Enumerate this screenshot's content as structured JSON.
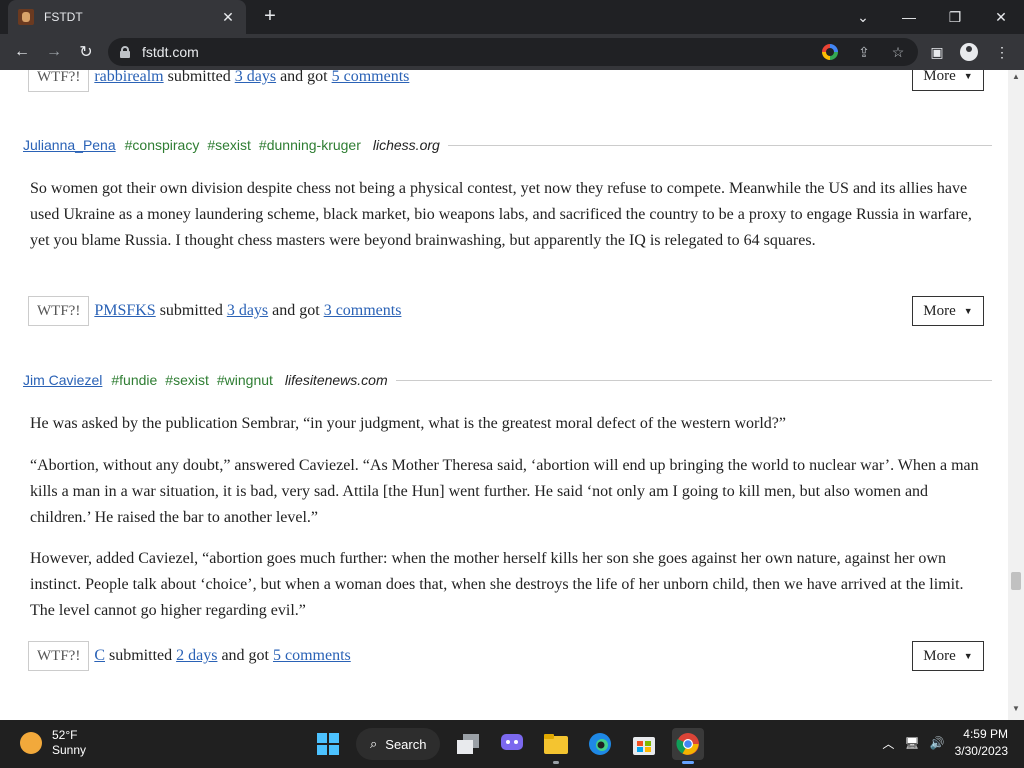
{
  "browser": {
    "tab_title": "FSTDT",
    "url": "fstdt.com"
  },
  "post0": {
    "wtf_label": "WTF?!",
    "user": "rabbirealm",
    "submitted_word": "submitted",
    "time": "3 days",
    "and_got": "and got",
    "comments": "5 comments",
    "more_label": "More"
  },
  "post1": {
    "author": "Julianna_Pena",
    "tags": [
      "#conspiracy",
      "#sexist",
      "#dunning-kruger"
    ],
    "source": "lichess.org",
    "paragraphs": [
      "So women got their own division despite chess not being a physical contest, yet now they refuse to compete. Meanwhile the US and its allies have used Ukraine as a money laundering scheme, black market, bio weapons labs, and sacrificed the country to be a proxy to engage Russia in warfare, yet you blame Russia. I thought chess masters were beyond brainwashing, but apparently the IQ is relegated to 64 squares."
    ],
    "wtf_label": "WTF?!",
    "user": "PMSFKS",
    "submitted_word": "submitted",
    "time": "3 days",
    "and_got": "and got",
    "comments": "3 comments",
    "more_label": "More"
  },
  "post2": {
    "author": "Jim Caviezel",
    "tags": [
      "#fundie",
      "#sexist",
      "#wingnut"
    ],
    "source": "lifesitenews.com",
    "paragraphs": [
      "He was asked by the publication Sembrar, “in your judgment, what is the greatest moral defect of the western world?”",
      "“Abortion, without any doubt,” answered Caviezel. “As Mother Theresa said, ‘abortion will end up bringing the world to nuclear war’. When a man kills a man in a war situation, it is bad, very sad.  Attila [the Hun] went further.  He said ‘not only am I going to kill men, but also women and children.’  He raised the bar to another level.”",
      "However, added Caviezel, “abortion goes much further: when the mother herself kills her son she goes against her own nature, against her own instinct.  People talk about ‘choice’, but when a woman does that, when she destroys the life of her unborn child, then we have arrived at the limit.  The level cannot go higher regarding evil.”"
    ],
    "wtf_label": "WTF?!",
    "user": "C",
    "submitted_word": "submitted",
    "time": "2 days",
    "and_got": "and got",
    "comments": "5 comments",
    "more_label": "More"
  },
  "taskbar": {
    "temperature": "52°F",
    "condition": "Sunny",
    "search_label": "Search",
    "time": "4:59 PM",
    "date": "3/30/2023"
  }
}
